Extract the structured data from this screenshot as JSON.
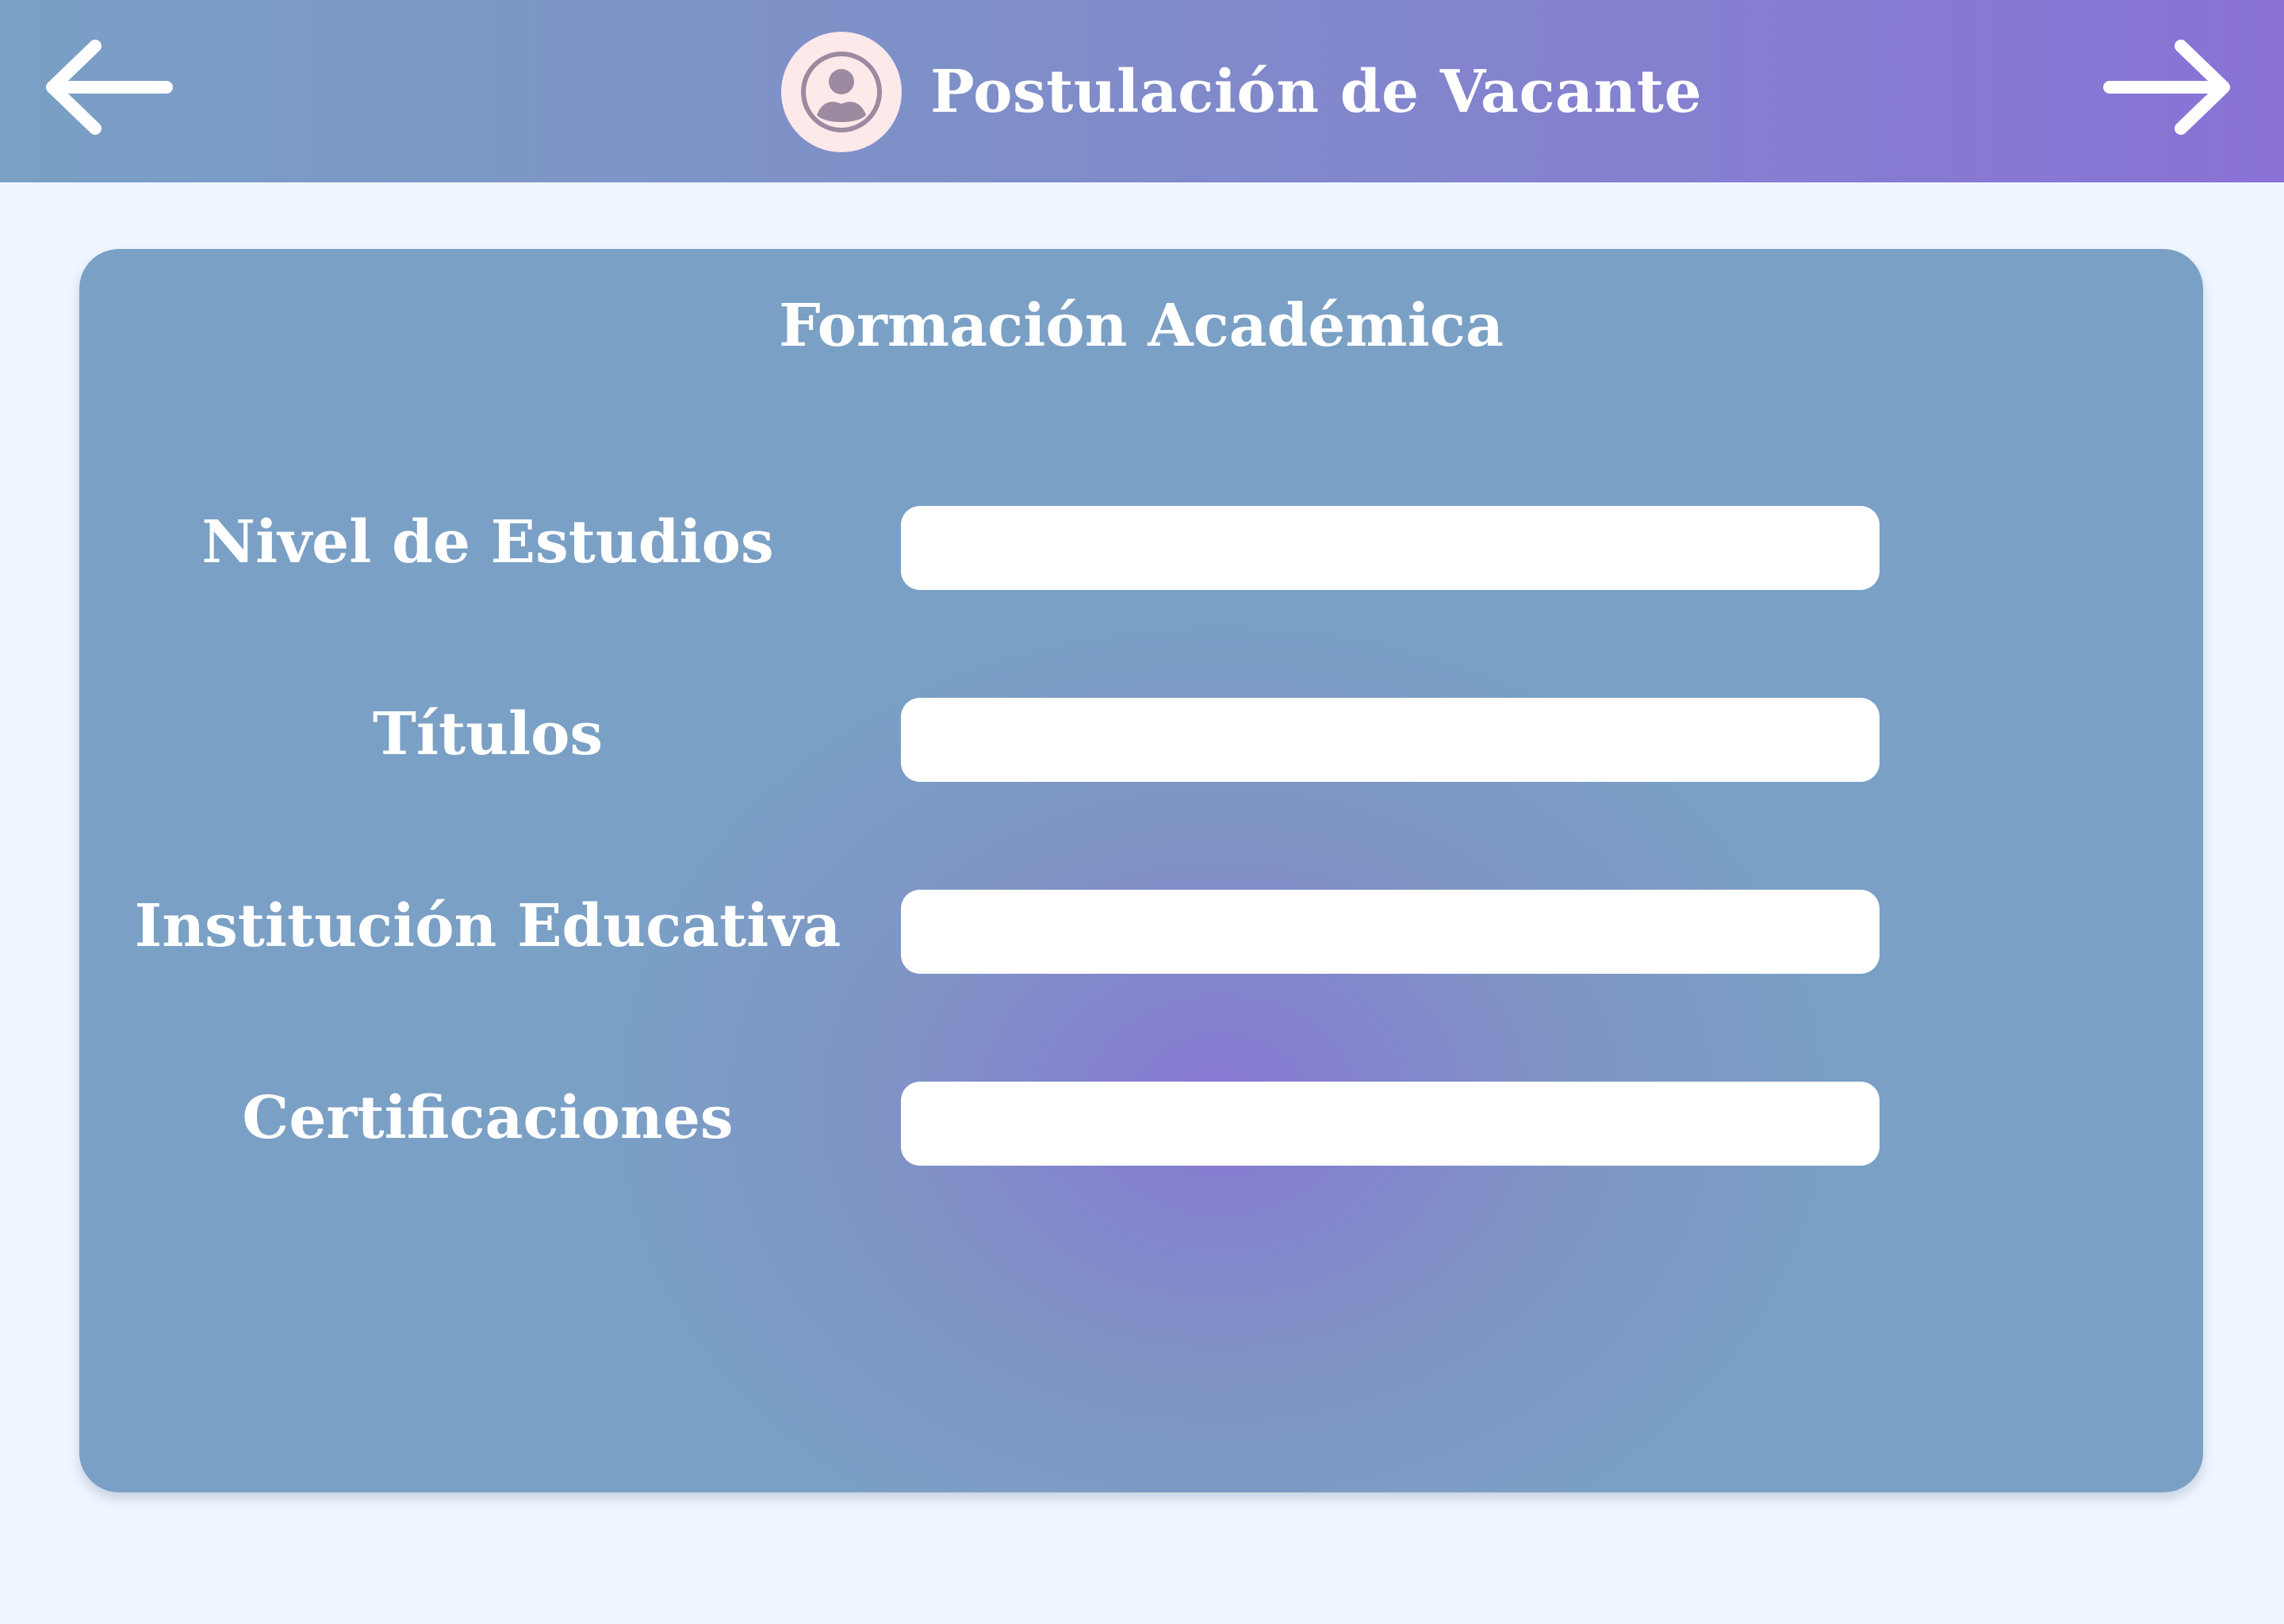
{
  "header": {
    "title": "Postulación de Vacante",
    "back_icon": "arrow-left-icon",
    "next_icon": "arrow-right-icon",
    "avatar_icon": "user-avatar-icon"
  },
  "form": {
    "section_title": "Formación Académica",
    "fields": [
      {
        "label": "Nivel de Estudios",
        "value": "",
        "placeholder": ""
      },
      {
        "label": "Títulos",
        "value": "",
        "placeholder": ""
      },
      {
        "label": "Institución Educativa",
        "value": "",
        "placeholder": ""
      },
      {
        "label": "Certificaciones",
        "value": "",
        "placeholder": ""
      }
    ]
  },
  "colors": {
    "header_gradient_start": "#7aa0c5",
    "header_gradient_end": "#8a72d6",
    "page_background": "#eff6ff",
    "card_base": "#7aa0c5",
    "card_center": "#8777d3",
    "avatar_background": "#fde8ea"
  }
}
